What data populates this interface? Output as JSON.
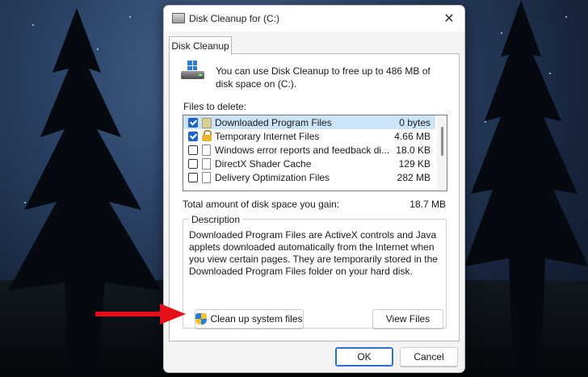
{
  "window": {
    "title": "Disk Cleanup for  (C:)",
    "close_symbol": "✕"
  },
  "tab": {
    "label": "Disk Cleanup"
  },
  "intro": "You can use Disk Cleanup to free up to 486 MB of disk space on  (C:).",
  "files": {
    "label": "Files to delete:",
    "items": [
      {
        "name": "Downloaded Program Files",
        "size": "0 bytes",
        "checked": true,
        "selected": true,
        "icon": "folder-icon"
      },
      {
        "name": "Temporary Internet Files",
        "size": "4.66 MB",
        "checked": true,
        "selected": false,
        "icon": "lock-icon"
      },
      {
        "name": "Windows error reports and feedback di...",
        "size": "18.0 KB",
        "checked": false,
        "selected": false,
        "icon": "document-icon"
      },
      {
        "name": "DirectX Shader Cache",
        "size": "129 KB",
        "checked": false,
        "selected": false,
        "icon": "document-icon"
      },
      {
        "name": "Delivery Optimization Files",
        "size": "282 MB",
        "checked": false,
        "selected": false,
        "icon": "document-icon"
      }
    ]
  },
  "total": {
    "label": "Total amount of disk space you gain:",
    "value": "18.7 MB"
  },
  "description": {
    "label": "Description",
    "text": "Downloaded Program Files are ActiveX controls and Java applets downloaded automatically from the Internet when you view certain pages. They are temporarily stored in the Downloaded Program Files folder on your hard disk."
  },
  "buttons": {
    "cleanup_system": "Clean up system files",
    "view_files": "View Files",
    "ok": "OK",
    "cancel": "Cancel"
  },
  "colors": {
    "accent": "#1f64c8",
    "selection": "#cce4f7",
    "annotation_arrow": "#e3101a"
  }
}
